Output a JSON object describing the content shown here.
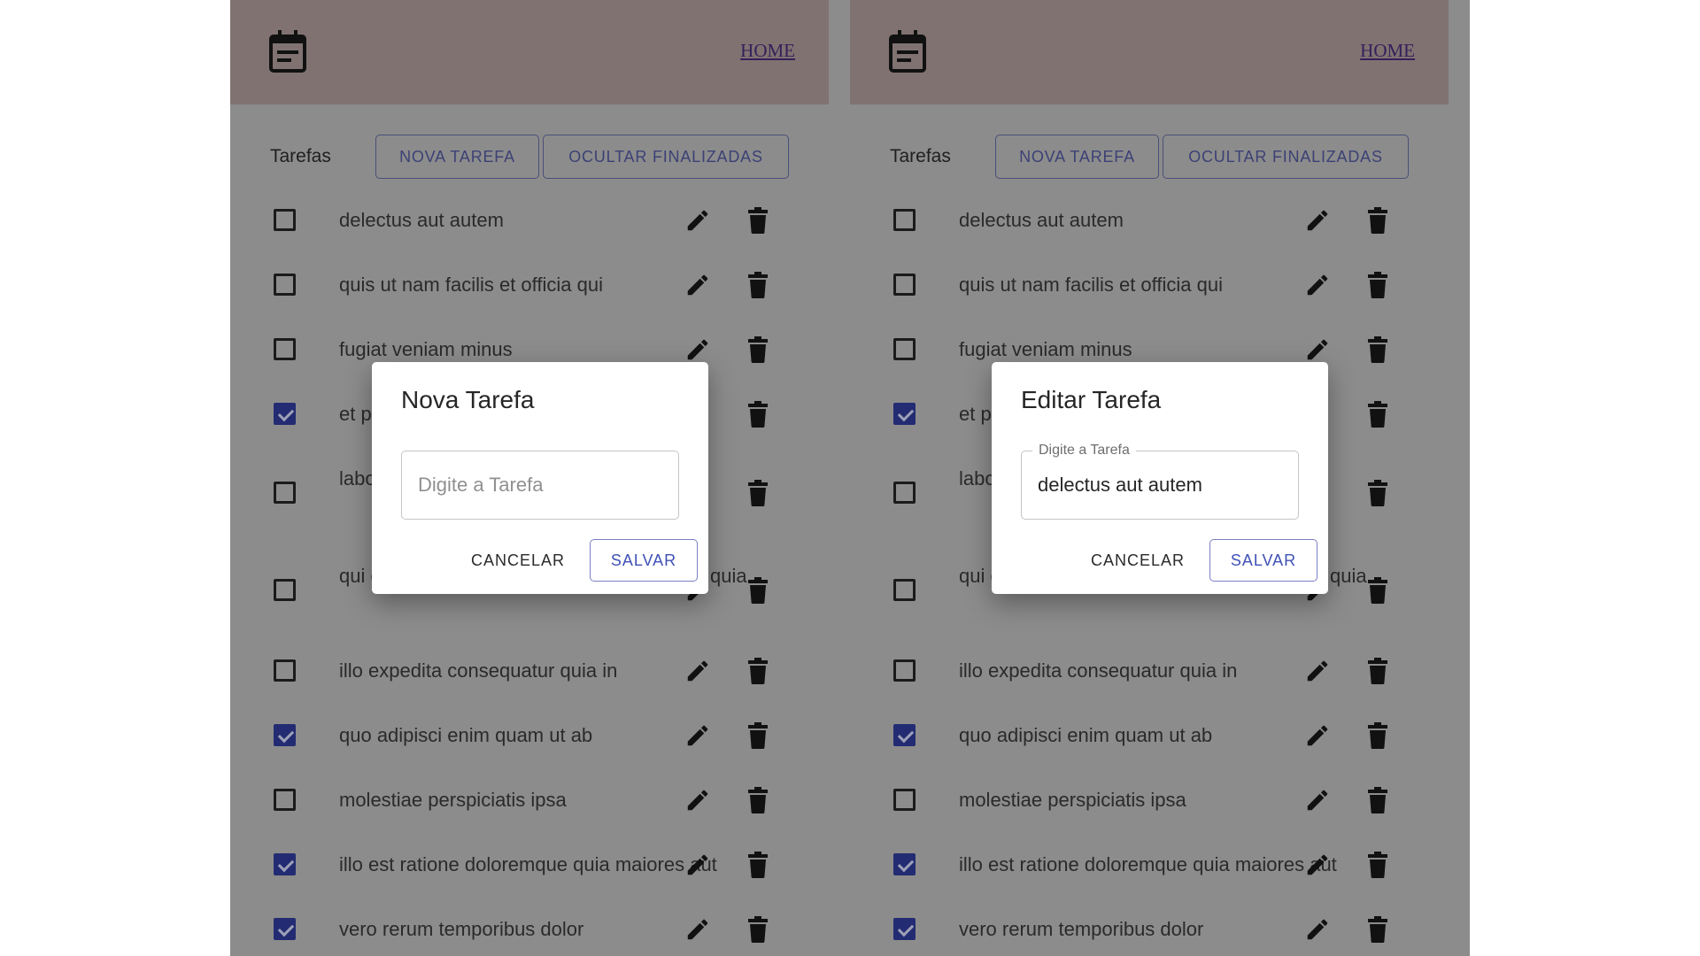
{
  "colors": {
    "backdrop": "#8c8c8c",
    "header": "#817272",
    "checkbox_checked": "#232c72",
    "primary": "#3f51b5"
  },
  "header": {
    "calendar_icon": "calendar-icon",
    "home_link": "HOME"
  },
  "toolbar": {
    "label": "Tarefas",
    "new_button": "NOVA TAREFA",
    "hide_button": "OCULTAR FINALIZADAS"
  },
  "tasks": [
    {
      "text": "delectus aut autem",
      "done": false
    },
    {
      "text": "quis ut nam facilis et officia qui",
      "done": false
    },
    {
      "text": "fugiat veniam minus",
      "done": false
    },
    {
      "text": "et p",
      "done": true
    },
    {
      "text": "labo quia",
      "done": false
    },
    {
      "text": "qui omnis",
      "done": false,
      "trailing": "quia"
    },
    {
      "text": "illo expedita consequatur quia in",
      "done": false
    },
    {
      "text": "quo adipisci enim quam ut ab",
      "done": true
    },
    {
      "text": "molestiae perspiciatis ipsa",
      "done": false
    },
    {
      "text": "illo est ratione doloremque quia maiores aut",
      "done": true
    },
    {
      "text": "vero rerum temporibus dolor",
      "done": true
    }
  ],
  "new_dialog": {
    "title": "Nova Tarefa",
    "placeholder": "Digite a Tarefa",
    "value": "",
    "cancel": "CANCELAR",
    "save": "SALVAR"
  },
  "edit_dialog": {
    "title": "Editar Tarefa",
    "field_label": "Digite a Tarefa",
    "value": "delectus aut autem",
    "cancel": "CANCELAR",
    "save": "SALVAR"
  }
}
